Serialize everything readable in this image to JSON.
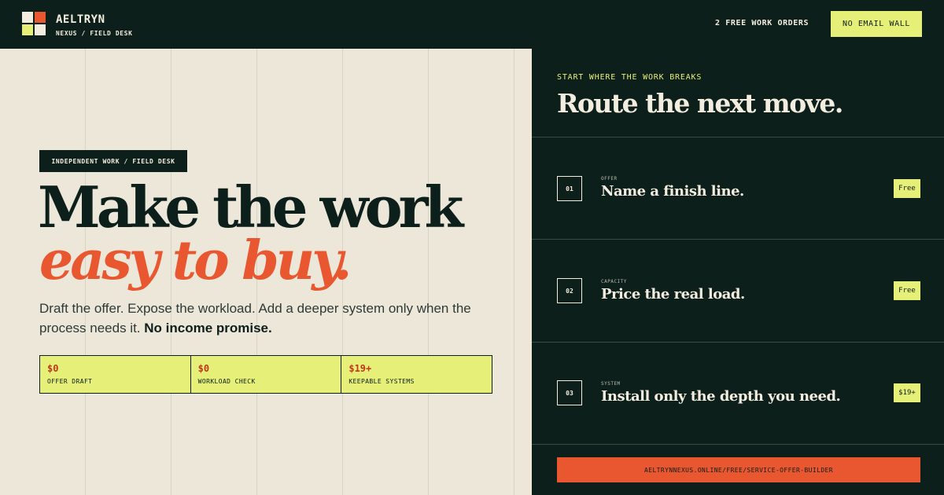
{
  "header": {
    "brand": "AELTRYN",
    "brand_sub": "NEXUS / FIELD DESK",
    "link": "2 FREE WORK ORDERS",
    "button": "NO EMAIL WALL"
  },
  "hero": {
    "tag": "INDEPENDENT WORK / FIELD DESK",
    "headline_1": "Make the work",
    "headline_2": "easy to buy.",
    "lede": "Draft the offer. Expose the workload. Add a deeper system only when the process needs it.",
    "lede_strong": "No income promise.",
    "stats": [
      {
        "value": "$0",
        "label": "OFFER DRAFT"
      },
      {
        "value": "$0",
        "label": "WORKLOAD CHECK"
      },
      {
        "value": "$19+",
        "label": "KEEPABLE SYSTEMS"
      }
    ]
  },
  "panel": {
    "eyebrow": "START WHERE THE WORK BREAKS",
    "title": "Route the next move.",
    "steps": [
      {
        "num": "01",
        "kicker": "OFFER",
        "title": "Name a finish line.",
        "badge": "Free"
      },
      {
        "num": "02",
        "kicker": "CAPACITY",
        "title": "Price the real load.",
        "badge": "Free"
      },
      {
        "num": "03",
        "kicker": "SYSTEM",
        "title": "Install only the depth you need.",
        "badge": "$19+"
      }
    ],
    "url": "AELTRYNNEXUS.ONLINE/FREE/SERVICE-OFFER-BUILDER"
  },
  "colors": {
    "ink": "#0d1f1a",
    "paper": "#ede7da",
    "accent": "#e8572f",
    "highlight": "#e6ef78"
  }
}
